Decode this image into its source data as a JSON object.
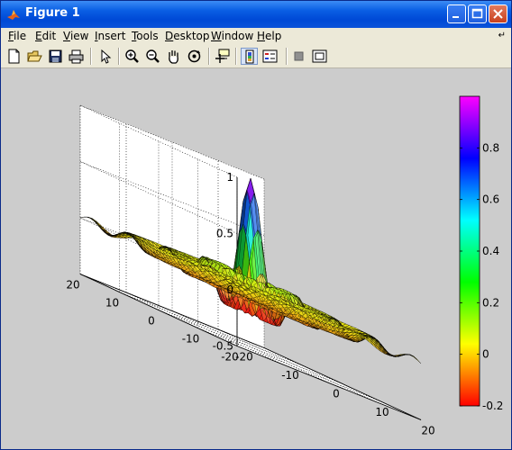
{
  "window": {
    "title": "Figure 1"
  },
  "menu": {
    "items": [
      {
        "label": "File",
        "ul": "F",
        "rest": "ile"
      },
      {
        "label": "Edit",
        "ul": "E",
        "rest": "dit"
      },
      {
        "label": "View",
        "ul": "V",
        "rest": "iew"
      },
      {
        "label": "Insert",
        "ul": "I",
        "rest": "nsert"
      },
      {
        "label": "Tools",
        "ul": "T",
        "rest": "ools"
      },
      {
        "label": "Desktop",
        "ul": "D",
        "rest": "esktop"
      },
      {
        "label": "Window",
        "ul": "W",
        "rest": "indow"
      },
      {
        "label": "Help",
        "ul": "H",
        "rest": "elp"
      }
    ]
  },
  "toolbar": {
    "buttons": [
      "new-figure-icon",
      "open-file-icon",
      "save-icon",
      "print-icon",
      "edit-plot-arrow-icon",
      "zoom-in-icon",
      "zoom-out-icon",
      "pan-hand-icon",
      "rotate-3d-icon",
      "data-cursor-icon",
      "colorbar-toggle-icon",
      "legend-toggle-icon",
      "hide-plot-tools-icon",
      "show-plot-tools-icon"
    ]
  },
  "chart_data": {
    "type": "surface",
    "function": "sinc radial: z = sin(r)/r, r = sqrt(x^2 + y^2)",
    "x_range": [
      -20,
      20
    ],
    "y_range": [
      -20,
      20
    ],
    "zlim": [
      -0.5,
      1
    ],
    "x_ticks": [
      "-20",
      "-10",
      "0",
      "10",
      "20"
    ],
    "y_ticks": [
      "-20",
      "-10",
      "0",
      "10",
      "20"
    ],
    "z_ticks": [
      "-0.5",
      "0",
      "0.5",
      "1"
    ],
    "grid": true,
    "colormap": "hsv",
    "colorbar": {
      "location": "right",
      "range": [
        -0.2,
        1.0
      ],
      "ticks": [
        "-0.2",
        "0",
        "0.2",
        "0.4",
        "0.6",
        "0.8"
      ]
    }
  }
}
